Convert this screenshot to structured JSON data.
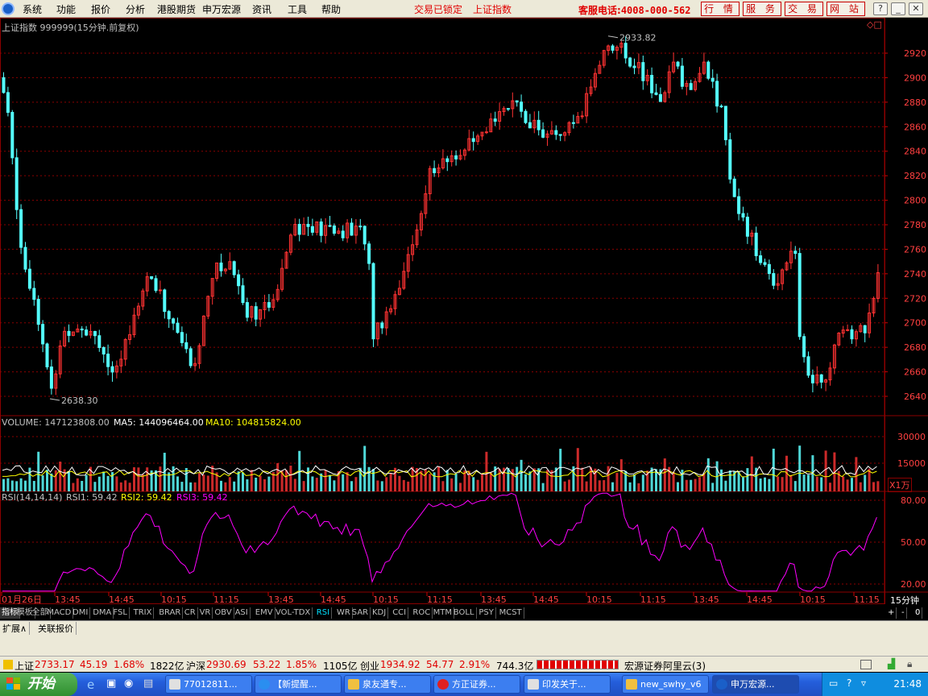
{
  "menu": {
    "items": [
      "系统",
      "功能",
      "报价",
      "分析",
      "港股期货",
      "申万宏源",
      "资讯",
      "工具",
      "帮助"
    ],
    "lock_status": "交易已锁定",
    "current_index": "上证指数",
    "hotline_label": "客服电话:",
    "hotline_number": "4008-000-562",
    "quick_buttons": [
      "行 情",
      "服 务",
      "交 易",
      "网 站"
    ]
  },
  "chart": {
    "title": "上证指数 999999(15分钟.前复权)",
    "high_label": "2933.82",
    "low_label": "2638.30",
    "price_axis": [
      "2920",
      "2900",
      "2880",
      "2860",
      "2840",
      "2820",
      "2800",
      "2780",
      "2760",
      "2740",
      "2720",
      "2700",
      "2680",
      "2660",
      "2640"
    ],
    "volume_title": "VOLUME: 147123808.00",
    "ma5_label": "MA5: 144096464.00",
    "ma10_label": "MA10: 104815824.00",
    "volume_axis": [
      "30000",
      "15000"
    ],
    "volume_unit": "X1万",
    "rsi_title": "RSI(14,14,14)",
    "rsi1_label": "RSI1: 59.42",
    "rsi2_label": "RSI2: 59.42",
    "rsi3_label": "RSI3: 59.42",
    "rsi_axis": [
      "80.00",
      "50.00",
      "20.00"
    ],
    "time_axis": [
      "01月26日",
      "13:45",
      "14:45",
      "10:15",
      "11:15",
      "13:45",
      "14:45",
      "10:15",
      "11:15",
      "13:45",
      "14:45",
      "10:15",
      "11:15",
      "13:45",
      "14:45",
      "10:15",
      "11:15"
    ],
    "period": "15分钟",
    "colors": {
      "up": "#ff3232",
      "down": "#54ffff",
      "ma5": "#ffffff",
      "ma10": "#ffff00",
      "rsi": "#ff00ff",
      "grid": "#8b0000"
    }
  },
  "indicator_tabs": [
    "指标",
    "模板",
    "全部",
    "MACD",
    "DMI",
    "DMA",
    "FSL",
    "TRIX",
    "BRAR",
    "CR",
    "VR",
    "OBV",
    "ASI",
    "EMV",
    "VOL-TDX",
    "RSI",
    "WR",
    "SAR",
    "KDJ",
    "CCI",
    "ROC",
    "MTM",
    "BOLL",
    "PSY",
    "MCST"
  ],
  "tab_controls": [
    "+",
    "-",
    "0"
  ],
  "ext_tabs": [
    "扩展∧",
    "关联报价"
  ],
  "ticker": {
    "sh_label": "上证",
    "sh_value": "2733.17",
    "sh_change": "45.19",
    "sh_pct": "1.68%",
    "sh_amount": "1822亿",
    "hs_label": "沪深",
    "hs_value": "2930.69",
    "hs_change": "53.22",
    "hs_pct": "1.85%",
    "hs_amount": "1105亿",
    "cy_label": "创业",
    "cy_value": "1934.92",
    "cy_change": "54.77",
    "cy_pct": "2.91%",
    "cy_amount": "744.3亿",
    "broker": "宏源证券阿里云(3)"
  },
  "taskbar": {
    "start_label": "开始",
    "buttons": [
      "77012811...",
      "【新提醒...",
      "泉友通专...",
      "方正证券...",
      "印发关于...",
      "new_swhy_v6",
      "申万宏源..."
    ],
    "clock": "21:48"
  }
}
